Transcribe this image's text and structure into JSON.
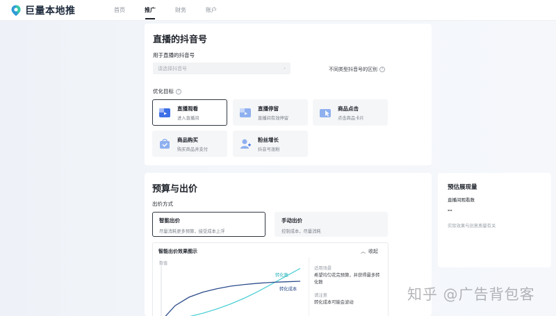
{
  "app": {
    "brand": "巨量本地推"
  },
  "nav": {
    "items": [
      "首页",
      "推广",
      "财务",
      "账户"
    ],
    "active_index": 1
  },
  "live_account": {
    "title": "直播的抖音号",
    "field_label": "用于直播的抖音号",
    "select_placeholder": "请选择抖音号",
    "diff_link": "不同类型抖音号的区别",
    "goal_label": "优化目标",
    "goals": [
      {
        "title": "直播观看",
        "subtitle": "进入直播间",
        "icon": "video-card-icon",
        "selected": true
      },
      {
        "title": "直播停留",
        "subtitle": "直播间有效停留",
        "icon": "video-card-icon",
        "selected": false
      },
      {
        "title": "商品点击",
        "subtitle": "点击商品卡片",
        "icon": "click-card-icon",
        "selected": false
      },
      {
        "title": "商品购买",
        "subtitle": "购买商品并支付",
        "icon": "shopping-bag-icon",
        "selected": false
      },
      {
        "title": "粉丝增长",
        "subtitle": "抖音号涨粉",
        "icon": "user-plus-icon",
        "selected": false
      }
    ]
  },
  "budget": {
    "title": "预算与出价",
    "bid_label": "出价方式",
    "bid_options": [
      {
        "title": "智能出价",
        "subtitle": "尽量消耗更多预算，接受成本上浮",
        "selected": true
      },
      {
        "title": "手动出价",
        "subtitle": "控制成本，尽量消耗",
        "selected": false
      }
    ],
    "chart": {
      "title": "智能出价效果图示",
      "collapse_label": "收起",
      "axis_label": "数值",
      "series_labels": [
        "转化数",
        "转化成本"
      ],
      "note_head_1": "适用场景",
      "note_body_1": "希望均匀花完预算，并获得最多转化数",
      "note_head_2": "请注意",
      "note_body_2": "转化成本可能会波动"
    }
  },
  "estimate": {
    "title": "预估展现量",
    "label": "直播间观看数",
    "value": "--",
    "note": "实际效果与创意质量有关"
  },
  "watermark": "知乎 @广告背包客",
  "colors": {
    "accent_dark": "#2f3640",
    "series_conv": "#4fd0d5",
    "series_cost": "#2a4a8a",
    "icon_blue": "#3d6fe6"
  },
  "chart_data": {
    "type": "line",
    "title": "智能出价效果图示",
    "xlabel": "",
    "ylabel": "数值",
    "x": [
      0,
      1,
      2,
      3,
      4,
      5,
      6,
      7,
      8,
      9,
      10
    ],
    "series": [
      {
        "name": "转化数",
        "values": [
          0,
          2,
          5,
          9,
          14,
          20,
          27,
          35,
          44,
          53,
          62
        ]
      },
      {
        "name": "转化成本",
        "values": [
          0,
          18,
          28,
          34,
          38,
          41,
          43,
          44.5,
          45.5,
          46.2,
          46.8
        ]
      }
    ],
    "ylim": [
      0,
      64
    ],
    "grid": false,
    "legend": "inline"
  }
}
